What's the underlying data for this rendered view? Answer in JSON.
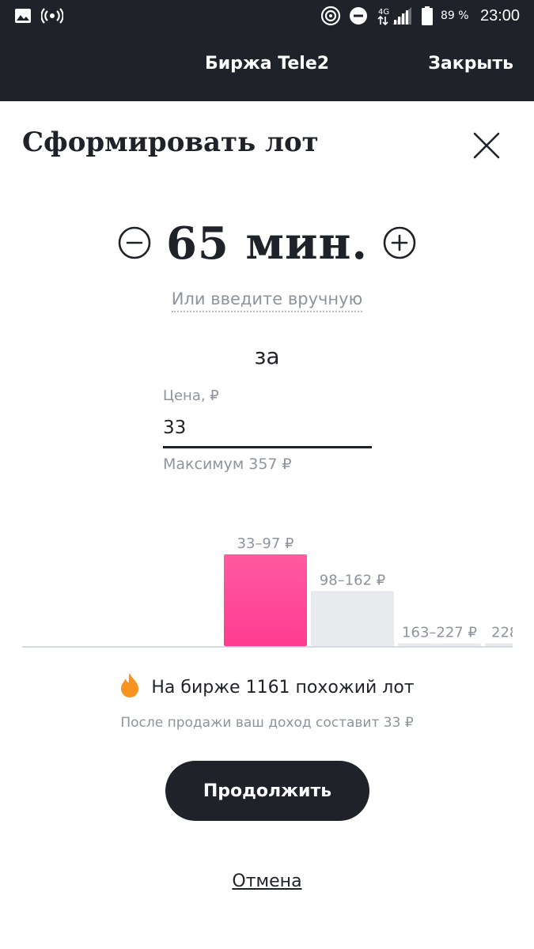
{
  "status_bar": {
    "battery_percent": "89 %",
    "time": "23:00",
    "network": "4G",
    "icons": [
      "image-icon",
      "broadcast-icon",
      "hotspot-icon",
      "do-not-disturb-icon",
      "signal-icon",
      "battery-icon"
    ]
  },
  "app_bar": {
    "title": "Биржа Tele2",
    "close_label": "Закрыть"
  },
  "sheet": {
    "title": "Сформировать лот",
    "close_icon": "close-icon"
  },
  "stepper": {
    "value": "65 мин.",
    "minus_icon": "minus-circle-icon",
    "plus_icon": "plus-circle-icon"
  },
  "manual_entry_link": "Или введите вручную",
  "for_label": "за",
  "price": {
    "label": "Цена, ₽",
    "value": "33",
    "hint": "Максимум 357 ₽"
  },
  "chart_data": {
    "type": "bar",
    "categories": [
      "33–97 ₽",
      "98–162 ₽",
      "163–227 ₽",
      "228"
    ],
    "values": [
      100,
      60,
      3,
      3
    ],
    "highlighted_index": 0,
    "colors": {
      "highlight_top": "#ff5aa0",
      "highlight_bottom": "#ff3c8e",
      "normal": "#e8e9ec",
      "baseline": "#d5dade",
      "label": "#8f949c"
    }
  },
  "similar_lots": {
    "icon": "fire-icon",
    "text": "На бирже 1161 похожий лот"
  },
  "income_text": "После продажи ваш доход составит 33 ₽",
  "buttons": {
    "continue": "Продолжить",
    "cancel": "Отмена"
  },
  "colors": {
    "dark": "#1f2229",
    "muted": "#8f949c",
    "accent_pink": "#ff3c8e",
    "fire_orange": "#f7931e"
  }
}
